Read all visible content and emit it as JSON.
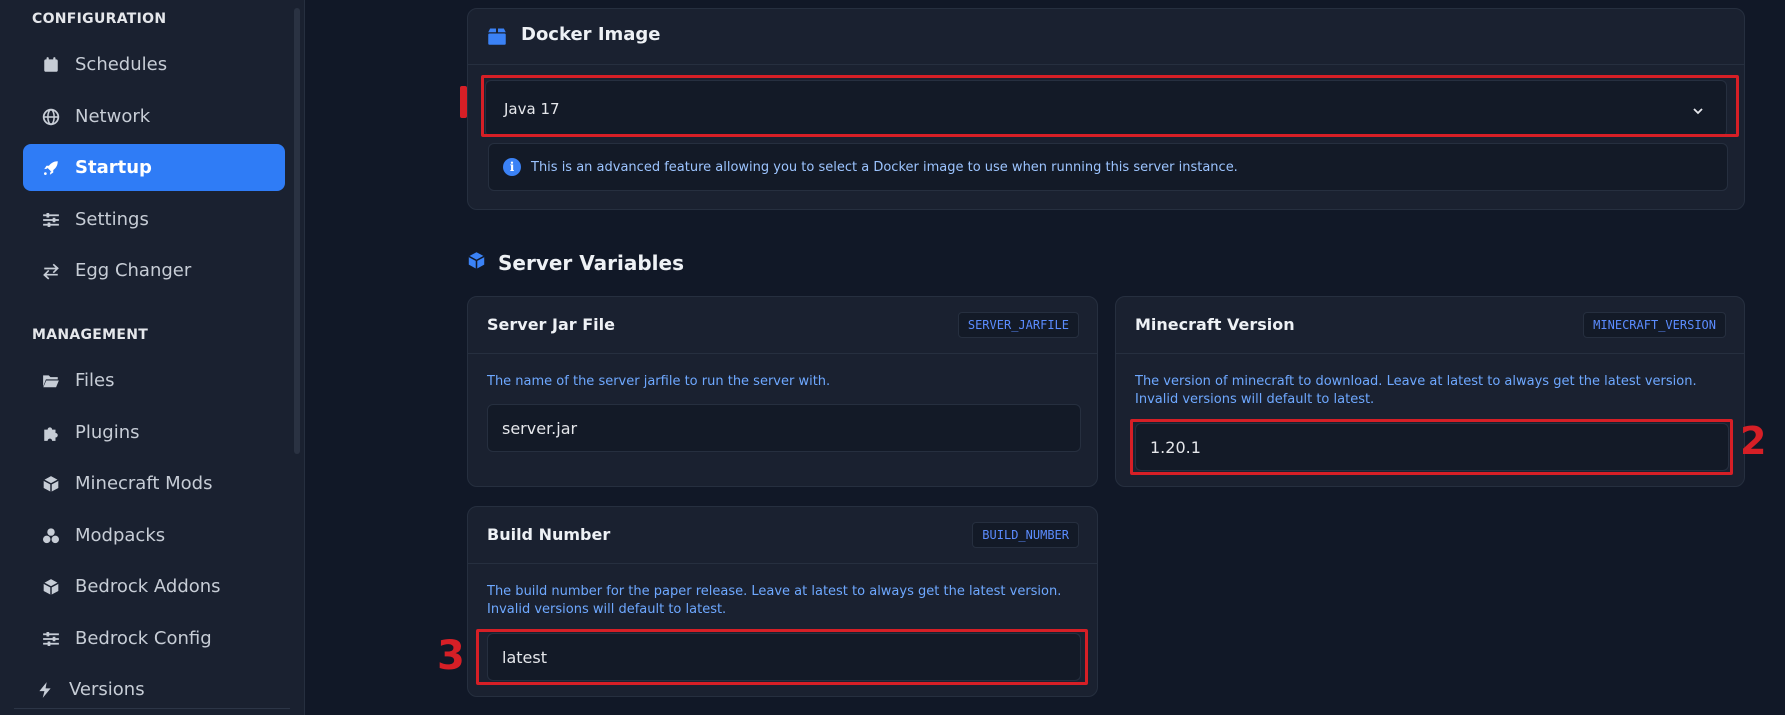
{
  "sidebar": {
    "configuration_label": "CONFIGURATION",
    "management_label": "MANAGEMENT",
    "config_items": [
      {
        "label": "Schedules",
        "icon": "calendar-icon"
      },
      {
        "label": "Network",
        "icon": "globe-icon"
      },
      {
        "label": "Startup",
        "icon": "rocket-icon",
        "active": true
      },
      {
        "label": "Settings",
        "icon": "sliders-icon"
      },
      {
        "label": "Egg Changer",
        "icon": "swap-icon"
      }
    ],
    "management_items": [
      {
        "label": "Files",
        "icon": "folder-icon"
      },
      {
        "label": "Plugins",
        "icon": "puzzle-icon"
      },
      {
        "label": "Minecraft Mods",
        "icon": "cube-icon"
      },
      {
        "label": "Modpacks",
        "icon": "cubes-icon"
      },
      {
        "label": "Bedrock Addons",
        "icon": "cube-icon"
      },
      {
        "label": "Bedrock Config",
        "icon": "sliders-icon"
      },
      {
        "label": "Versions",
        "icon": "bolt-icon"
      }
    ]
  },
  "docker": {
    "title": "Docker Image",
    "selected": "Java 17",
    "info": "This is an advanced feature allowing you to select a Docker image to use when running this server instance."
  },
  "server_variables": {
    "title": "Server Variables",
    "vars": [
      {
        "title": "Server Jar File",
        "env": "SERVER_JARFILE",
        "description": "The name of the server jarfile to run the server with.",
        "value": "server.jar"
      },
      {
        "title": "Minecraft Version",
        "env": "MINECRAFT_VERSION",
        "description": "The version of minecraft to download. Leave at latest to always get the latest version. Invalid versions will default to latest.",
        "value": "1.20.1"
      },
      {
        "title": "Build Number",
        "env": "BUILD_NUMBER",
        "description": "The build number for the paper release. Leave at latest to always get the latest version. Invalid versions will default to latest.",
        "value": "latest"
      }
    ]
  },
  "annotations": [
    "2",
    "3"
  ],
  "colors": {
    "accent": "#2f7cf6",
    "highlight": "#d61f26",
    "background": "#111827",
    "panel": "#1a2130"
  }
}
